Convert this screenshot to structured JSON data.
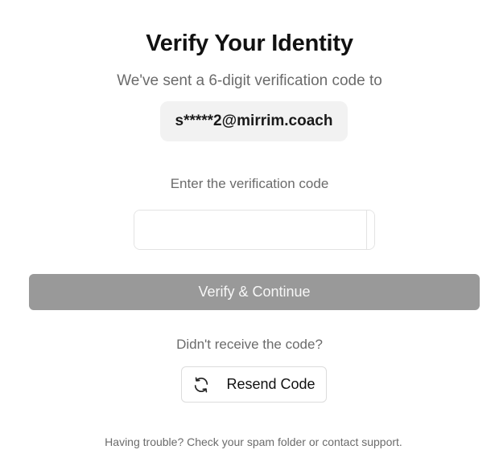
{
  "heading": "Verify Your Identity",
  "subtitle": "We've sent a 6-digit verification code to",
  "email": "s*****2@mirrim.coach",
  "code_label": "Enter the verification code",
  "code_inputs": [
    "",
    "",
    "",
    "",
    "",
    ""
  ],
  "verify_button": "Verify & Continue",
  "no_code_text": "Didn't receive the code?",
  "resend_button": {
    "label": "Resend Code",
    "icon": "refresh-icon"
  },
  "help_text": "Having trouble? Check your spam folder or contact support.",
  "colors": {
    "verify_button_bg": "#999999",
    "email_pill_bg": "#f2f2f2",
    "muted_text": "#6b6b6b"
  }
}
